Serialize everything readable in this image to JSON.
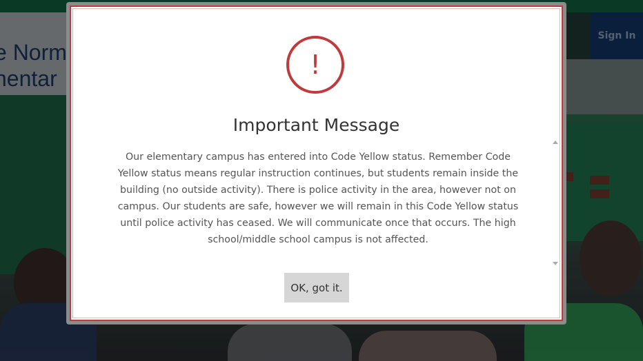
{
  "site": {
    "logo_line1": "e Norm",
    "logo_line2": "nentar",
    "sign_in_label": "Sign In"
  },
  "modal": {
    "icon": "exclamation-circle-icon",
    "title": "Important Message",
    "message": "Our elementary campus has entered into Code Yellow status. Remember Code Yellow status means regular instruction continues, but students remain inside the building (no outside activity). There is police activity in the area, however not on campus. Our students are safe, however we will remain in this Code Yellow status until police activity has ceased. We will communicate once that occurs. The high school/middle school campus is not affected.",
    "button_label": "OK, got it."
  },
  "colors": {
    "accent": "#c0393b",
    "button_bg": "#d6d6d6",
    "header_blue": "#123a6e"
  }
}
